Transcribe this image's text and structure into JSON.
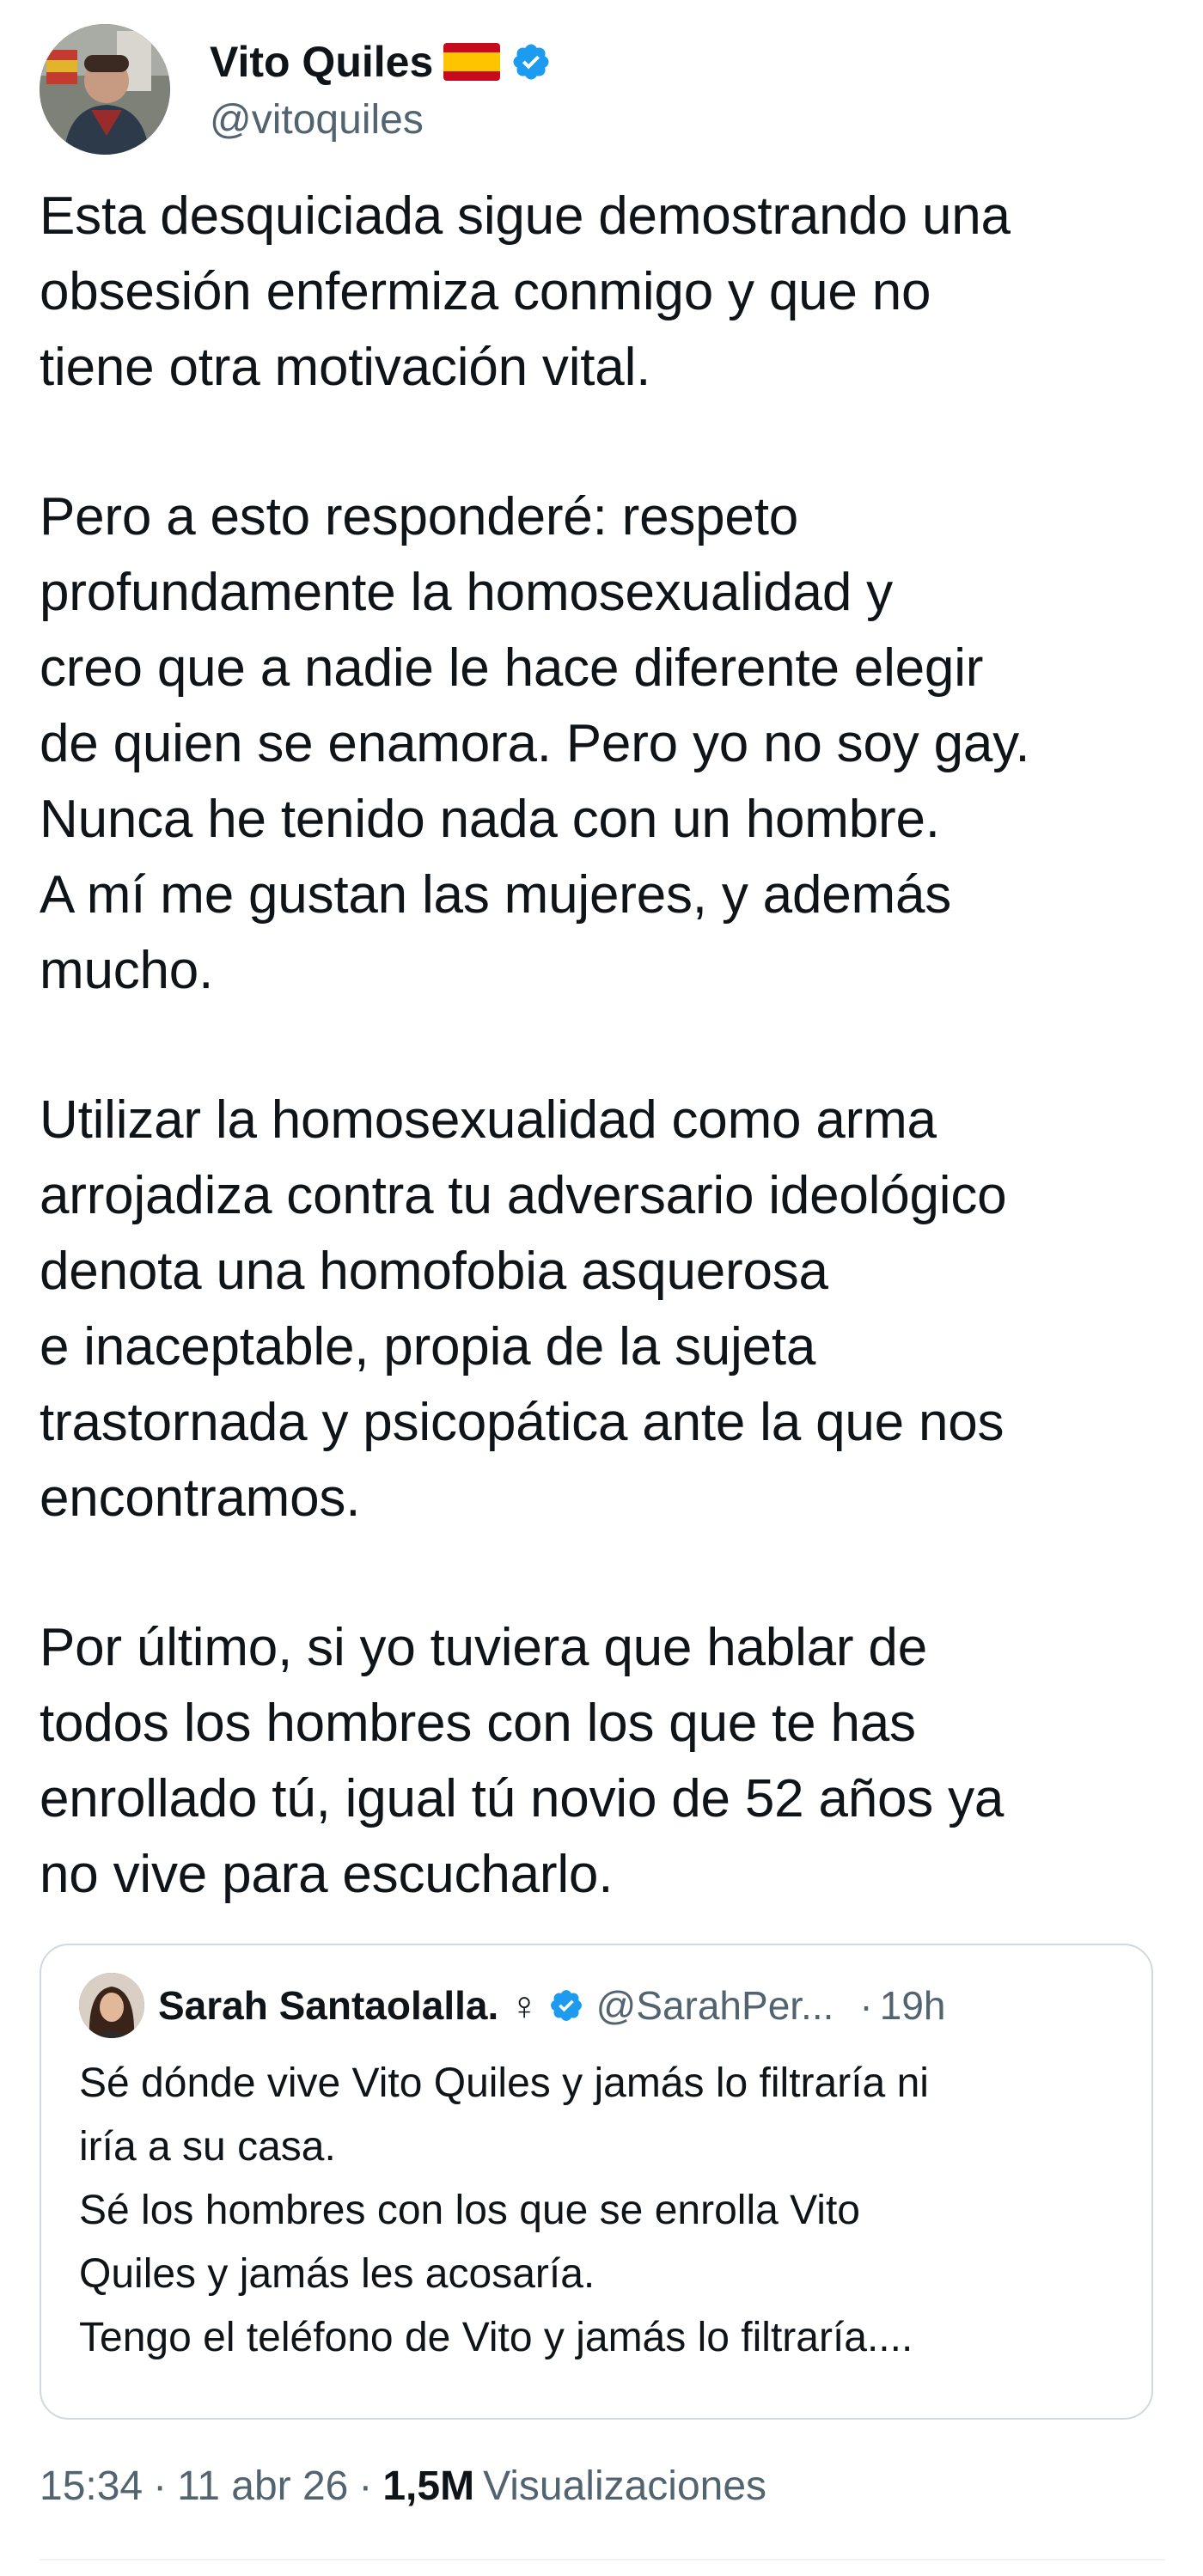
{
  "author": {
    "display_name": "Vito Quiles",
    "flag_emoji": "🇪🇸",
    "handle": "@vitoquiles",
    "avatar_icon": "profile-photo",
    "verified_icon": "verified-badge-icon",
    "verified_color": "#1d9bf0"
  },
  "tweet": {
    "paragraphs": [
      {
        "lines": [
          "Esta desquiciada sigue demostrando una",
          "obsesión enfermiza conmigo y que no",
          "tiene otra motivación vital."
        ]
      },
      {
        "lines": [
          "Pero a esto responderé: respeto",
          "profundamente la homosexualidad y",
          "creo que a nadie le hace diferente elegir",
          "de quien se enamora. Pero yo no soy gay.",
          "Nunca he tenido nada con un hombre.",
          "A mí me gustan las mujeres, y además",
          "mucho."
        ]
      },
      {
        "lines": [
          "Utilizar la homosexualidad como arma",
          "arrojadiza contra tu adversario ideológico",
          "denota una homofobia asquerosa",
          "e inaceptable, propia de la sujeta",
          "trastornada y psicopática ante la que nos",
          "encontramos."
        ]
      },
      {
        "lines": [
          "Por último, si yo tuviera que hablar de",
          "todos los hombres con los que te has",
          "enrollado tú, igual tú novio de 52 años ya",
          "no vive para escucharlo."
        ]
      }
    ]
  },
  "quoted_tweet": {
    "display_name": "Sarah Santaolalla. ♀",
    "handle": "@SarahPer...",
    "separator": "·",
    "time": "19h",
    "lines": [
      "Sé dónde vive Vito Quiles y jamás lo filtraría ni",
      "iría a su casa.",
      "Sé los hombres con los que se enrolla Vito",
      "Quiles y jamás les acosaría.",
      "Tengo el teléfono de Vito y jamás lo filtraría...."
    ]
  },
  "meta": {
    "time": "15:34",
    "dot": "·",
    "date": "11 abr 26",
    "views_count": "1,5M",
    "views_label": "Visualizaciones"
  },
  "colors": {
    "text_primary": "#0f1419",
    "text_secondary": "#536471",
    "border": "#cfd9de",
    "verified_blue": "#1d9bf0"
  }
}
